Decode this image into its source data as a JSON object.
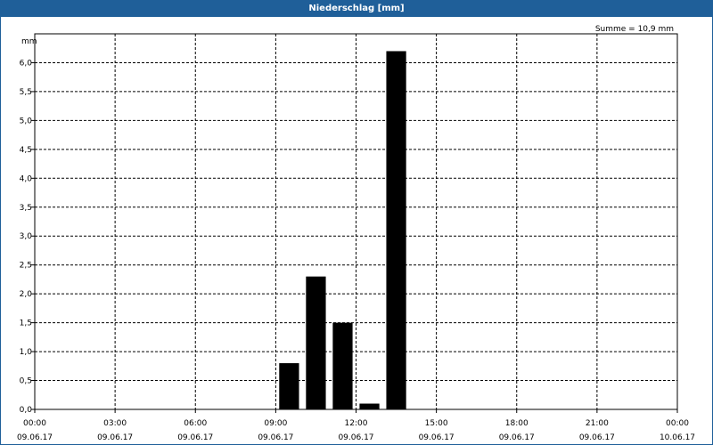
{
  "window": {
    "title": "Niederschlag [mm]"
  },
  "chart_data": {
    "type": "bar",
    "title": "Niederschlag [mm]",
    "ylabel": "mm",
    "xlabel": "",
    "annotation": "Summe = 10,9 mm",
    "ylim": [
      0,
      6.5
    ],
    "yticks": [
      "0,0",
      "0,5",
      "1,0",
      "1,5",
      "2,0",
      "2,5",
      "3,0",
      "3,5",
      "4,0",
      "4,5",
      "5,0",
      "5,5",
      "6,0"
    ],
    "xticks": [
      {
        "time": "00:00",
        "date": "09.06.17"
      },
      {
        "time": "03:00",
        "date": "09.06.17"
      },
      {
        "time": "06:00",
        "date": "09.06.17"
      },
      {
        "time": "09:00",
        "date": "09.06.17"
      },
      {
        "time": "12:00",
        "date": "09.06.17"
      },
      {
        "time": "15:00",
        "date": "09.06.17"
      },
      {
        "time": "18:00",
        "date": "09.06.17"
      },
      {
        "time": "21:00",
        "date": "09.06.17"
      },
      {
        "time": "00:00",
        "date": "10.06.17"
      }
    ],
    "x_unit": "hour of 09.06.17",
    "categories": [
      "09:00",
      "10:00",
      "11:00",
      "12:00",
      "13:00"
    ],
    "bars": [
      {
        "start": "09.06.17 09:00",
        "value": 0.8
      },
      {
        "start": "09.06.17 10:00",
        "value": 2.3
      },
      {
        "start": "09.06.17 11:00",
        "value": 1.5
      },
      {
        "start": "09.06.17 12:00",
        "value": 0.1
      },
      {
        "start": "09.06.17 13:00",
        "value": 6.2
      }
    ],
    "grid": true,
    "bar_color": "#000000",
    "title_bar_color": "#1f5f99"
  }
}
